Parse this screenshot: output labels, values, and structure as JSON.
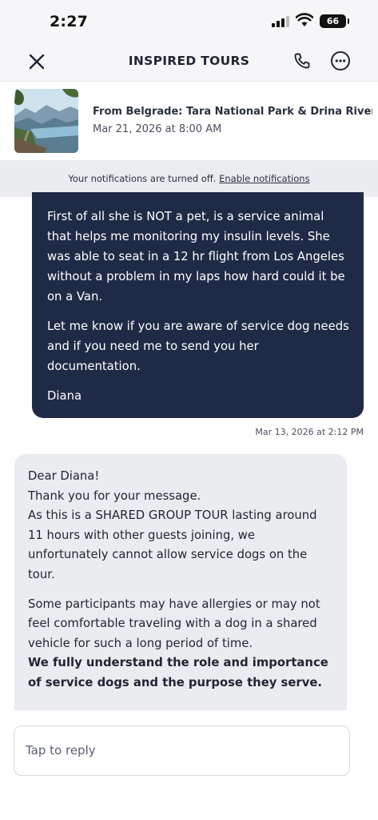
{
  "status_bar": {
    "time": "2:27",
    "battery": "66",
    "icons": [
      "signal-icon",
      "wifi-icon",
      "battery-icon"
    ]
  },
  "nav": {
    "title": "INSPIRED TOURS",
    "icons": [
      "close-icon",
      "phone-icon",
      "more-icon"
    ]
  },
  "tour": {
    "name": "From Belgrade: Tara National Park & Drina River...",
    "date": "Mar 21, 2026 at 8:00 AM"
  },
  "notice": {
    "text": "Your notifications are turned off.",
    "link": "Enable notifications"
  },
  "outgoing_message": {
    "paragraphs": [
      "First of all she is NOT a pet, is a service animal that helps me monitoring my insulin levels. She was able to seat in a 12 hr flight from Los Angeles without a problem in my laps how hard could it be on a Van.",
      "Let me know if you are aware of service dog needs and if you need me to send you her documentation.",
      "Diana"
    ],
    "timestamp": "Mar 13, 2026 at 2:12 PM"
  },
  "incoming_message": {
    "lines1": [
      "Dear Diana!",
      "Thank you for your message.",
      "As this is a SHARED GROUP TOUR lasting around 11 hours with other guests joining, we unfortunately cannot allow service dogs on the tour."
    ],
    "para2": "Some participants may have allergies or may not feel comfortable traveling with a dog in a shared vehicle for such a long period of time.",
    "bold_text": "We fully understand the role and importance of service dogs and the purpose they serve."
  },
  "reply": {
    "placeholder": "Tap to reply"
  },
  "colors": {
    "outgoing_bubble": "#1f2a46",
    "incoming_bubble": "#ebecf0",
    "header_bg": "#f6f6f8"
  }
}
